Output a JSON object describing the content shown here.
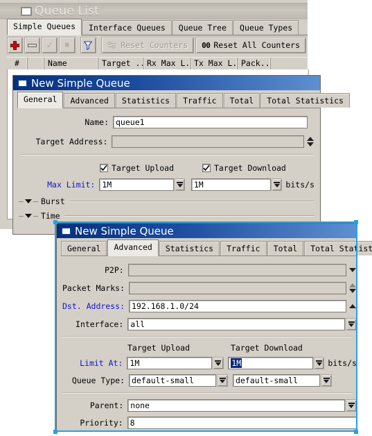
{
  "queue_list": {
    "title": "Queue List",
    "window_icon": "window-square-icon",
    "tabs": [
      {
        "label": "Simple Queues",
        "active": true
      },
      {
        "label": "Interface Queues",
        "active": false
      },
      {
        "label": "Queue Tree",
        "active": false
      },
      {
        "label": "Queue Types",
        "active": false
      }
    ],
    "toolbar": {
      "add_icon": "plus-icon",
      "remove_icon": "minus-icon",
      "enable_icon": "check-icon",
      "disable_icon": "cross-icon",
      "filter_icon": "funnel-icon",
      "reset_counters_label": "Reset Counters",
      "reset_counters_icon": "reset-counters-icon",
      "reset_all_counters_label": "Reset All Counters",
      "reset_all_counters_icon": "00"
    },
    "columns": [
      "#",
      "",
      "Name",
      "Target ...",
      "Rx Max L...",
      "Tx Max L...",
      "Pack...",
      ""
    ],
    "rows": []
  },
  "dialog_general": {
    "title": "New Simple Queue",
    "window_icon": "window-square-icon",
    "tabs": [
      {
        "label": "General",
        "active": true
      },
      {
        "label": "Advanced",
        "active": false
      },
      {
        "label": "Statistics",
        "active": false
      },
      {
        "label": "Traffic",
        "active": false
      },
      {
        "label": "Total",
        "active": false
      },
      {
        "label": "Total Statistics",
        "active": false
      }
    ],
    "fields": {
      "name_label": "Name:",
      "name_value": "queue1",
      "target_address_label": "Target Address:",
      "target_address_value": "",
      "target_upload_label": "Target Upload",
      "target_upload_checked": true,
      "target_download_label": "Target Download",
      "target_download_checked": true,
      "max_limit_label": "Max Limit:",
      "max_limit_upload": "1M",
      "max_limit_download": "1M",
      "units": "bits/s"
    },
    "sections": [
      {
        "label": "Burst"
      },
      {
        "label": "Time"
      }
    ]
  },
  "dialog_advanced": {
    "title": "New Simple Queue",
    "window_icon": "window-square-icon",
    "tabs": [
      {
        "label": "General",
        "active": false
      },
      {
        "label": "Advanced",
        "active": true
      },
      {
        "label": "Statistics",
        "active": false
      },
      {
        "label": "Traffic",
        "active": false
      },
      {
        "label": "Total",
        "active": false
      },
      {
        "label": "Total Statistics",
        "active": false
      }
    ],
    "fields": {
      "p2p_label": "P2P:",
      "p2p_value": "",
      "packet_marks_label": "Packet Marks:",
      "packet_marks_value": "",
      "dst_address_label": "Dst. Address:",
      "dst_address_value": "192.168.1.0/24",
      "interface_label": "Interface:",
      "interface_value": "all",
      "target_upload_header": "Target Upload",
      "target_download_header": "Target Download",
      "limit_at_label": "Limit At:",
      "limit_at_upload": "1M",
      "limit_at_download": "1M",
      "limit_at_download_selected": true,
      "units": "bits/s",
      "queue_type_label": "Queue Type:",
      "queue_type_upload": "default-small",
      "queue_type_download": "default-small",
      "parent_label": "Parent:",
      "parent_value": "none",
      "priority_label": "Priority:",
      "priority_value": "8"
    },
    "selected": true
  },
  "colors": {
    "dialog_titlebar_start": "#04307c",
    "dialog_titlebar_end": "#5e8fd0",
    "face": "#d4d0c8",
    "accent_label": "#1414cc",
    "selection": "#0a2a7a",
    "selection_frame": "#2a9fe0",
    "add_icon": "#d01010"
  }
}
